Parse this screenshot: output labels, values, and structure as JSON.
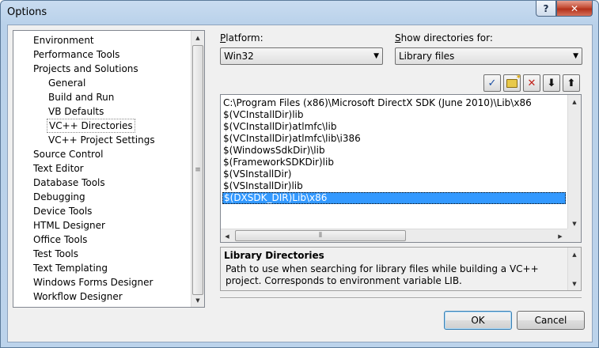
{
  "window": {
    "title": "Options",
    "help": "?",
    "close": "✕"
  },
  "tree": {
    "items": [
      {
        "label": "Environment",
        "indent": 0
      },
      {
        "label": "Performance Tools",
        "indent": 0
      },
      {
        "label": "Projects and Solutions",
        "indent": 0
      },
      {
        "label": "General",
        "indent": 1
      },
      {
        "label": "Build and Run",
        "indent": 1
      },
      {
        "label": "VB Defaults",
        "indent": 1
      },
      {
        "label": "VC++ Directories",
        "indent": 1,
        "selected": true
      },
      {
        "label": "VC++ Project Settings",
        "indent": 1
      },
      {
        "label": "Source Control",
        "indent": 0
      },
      {
        "label": "Text Editor",
        "indent": 0
      },
      {
        "label": "Database Tools",
        "indent": 0
      },
      {
        "label": "Debugging",
        "indent": 0
      },
      {
        "label": "Device Tools",
        "indent": 0
      },
      {
        "label": "HTML Designer",
        "indent": 0
      },
      {
        "label": "Office Tools",
        "indent": 0
      },
      {
        "label": "Test Tools",
        "indent": 0
      },
      {
        "label": "Text Templating",
        "indent": 0
      },
      {
        "label": "Windows Forms Designer",
        "indent": 0
      },
      {
        "label": "Workflow Designer",
        "indent": 0
      }
    ]
  },
  "platform": {
    "label": "Platform:",
    "value": "Win32"
  },
  "show_dirs": {
    "label": "Show directories for:",
    "value": "Library files"
  },
  "toolbar": [
    {
      "name": "new-line-button",
      "icon": "checkmark-icon",
      "glyph": "✓",
      "color": "#1c4fa3"
    },
    {
      "name": "new-folder-button",
      "icon": "folder-icon",
      "glyph": "",
      "color": "#e8c94a"
    },
    {
      "name": "delete-button",
      "icon": "delete-x-icon",
      "glyph": "✕",
      "color": "#c0221b"
    },
    {
      "name": "move-down-button",
      "icon": "arrow-down-icon",
      "glyph": "⬇",
      "color": "#111111"
    },
    {
      "name": "move-up-button",
      "icon": "arrow-up-icon",
      "glyph": "⬆",
      "color": "#111111"
    }
  ],
  "directories": [
    "C:\\Program Files (x86)\\Microsoft DirectX SDK (June 2010)\\Lib\\x86",
    "$(VCInstallDir)lib",
    "$(VCInstallDir)atlmfc\\lib",
    "$(VCInstallDir)atlmfc\\lib\\i386",
    "$(WindowsSdkDir)\\lib",
    "$(FrameworkSDKDir)lib",
    "$(VSInstallDir)",
    "$(VSInstallDir)lib",
    "$(DXSDK_DIR)Lib\\x86"
  ],
  "selected_directory_index": 8,
  "description": {
    "title": "Library Directories",
    "text": "Path to use when searching for library files while building a VC++ project. Corresponds to environment variable LIB."
  },
  "buttons": {
    "ok": "OK",
    "cancel": "Cancel"
  },
  "colors": {
    "selection": "#3399ff",
    "accent": "#3c7fb1"
  }
}
